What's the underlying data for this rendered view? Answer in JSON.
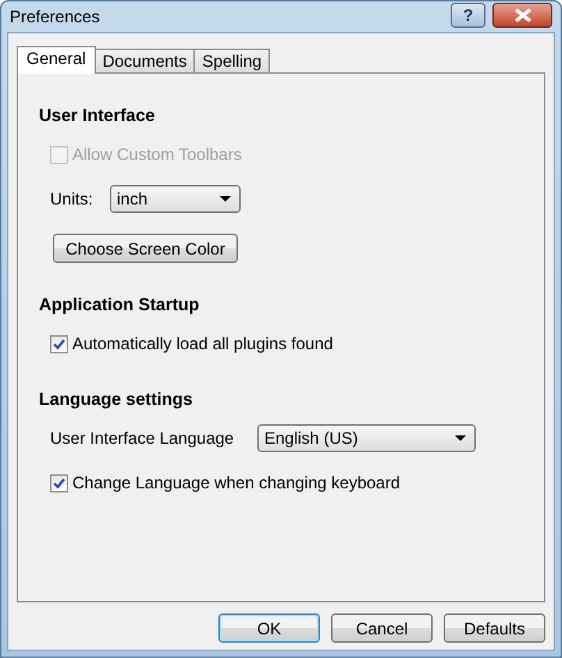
{
  "window": {
    "title": "Preferences",
    "help_label": "?"
  },
  "tabs": [
    {
      "label": "General",
      "selected": true
    },
    {
      "label": "Documents",
      "selected": false
    },
    {
      "label": "Spelling",
      "selected": false
    }
  ],
  "sections": [
    {
      "heading": "User Interface",
      "items": [
        {
          "kind": "checkbox",
          "label": "Allow Custom Toolbars",
          "checked": false,
          "disabled": true
        },
        {
          "kind": "dropdown",
          "label": "Units:",
          "value": "inch"
        },
        {
          "kind": "button",
          "label": "Choose Screen Color"
        }
      ]
    },
    {
      "heading": "Application Startup",
      "items": [
        {
          "kind": "checkbox",
          "label": "Automatically load all plugins found",
          "checked": true,
          "disabled": false
        }
      ]
    },
    {
      "heading": "Language settings",
      "items": [
        {
          "kind": "dropdown",
          "label": "User Interface Language",
          "value": "English (US)"
        },
        {
          "kind": "checkbox",
          "label": "Change Language when changing keyboard",
          "checked": true,
          "disabled": false
        }
      ]
    }
  ],
  "buttons": [
    {
      "label": "OK",
      "default": true
    },
    {
      "label": "Cancel",
      "default": false
    },
    {
      "label": "Defaults",
      "default": false
    }
  ]
}
